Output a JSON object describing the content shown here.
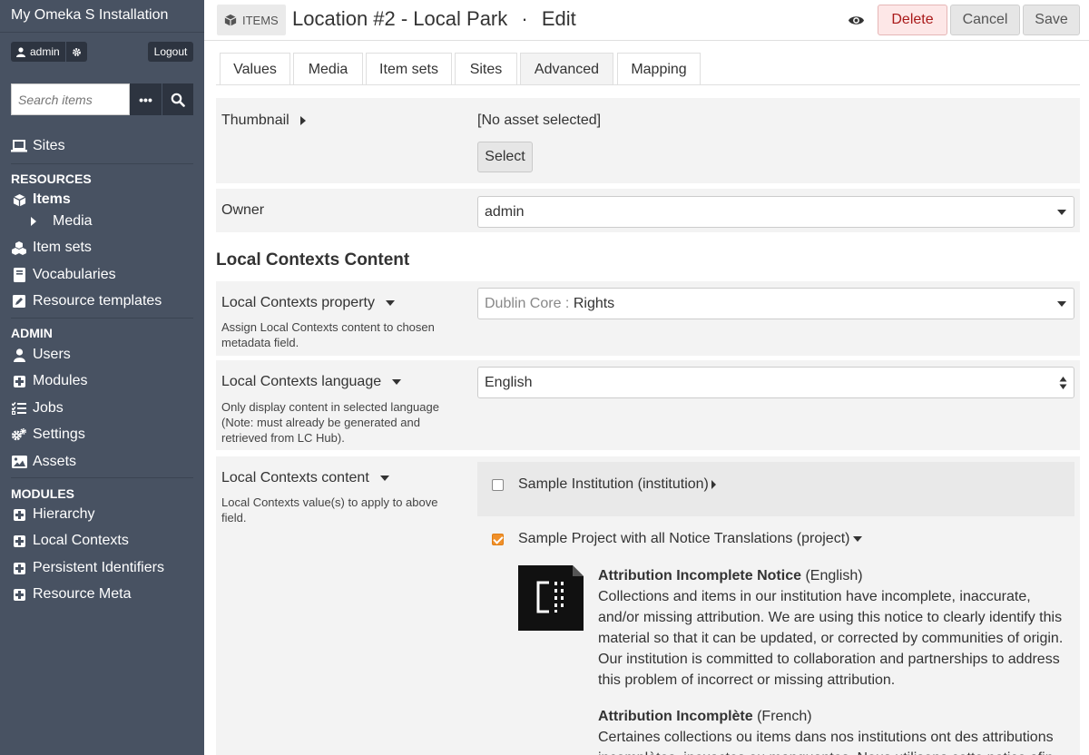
{
  "sidebar": {
    "install_title": "My Omeka S Installation",
    "user_name": "admin",
    "logout_label": "Logout",
    "search_placeholder": "Search items",
    "search_options_label": "•••",
    "sites_label": "Sites",
    "resources_heading": "RESOURCES",
    "items_label": "Items",
    "media_label": "Media",
    "item_sets_label": "Item sets",
    "vocabularies_label": "Vocabularies",
    "resource_templates_label": "Resource templates",
    "admin_heading": "ADMIN",
    "users_label": "Users",
    "modules_label": "Modules",
    "jobs_label": "Jobs",
    "settings_label": "Settings",
    "assets_label": "Assets",
    "modules_heading": "MODULES",
    "hierarchy_label": "Hierarchy",
    "local_contexts_label": "Local Contexts",
    "persistent_identifiers_label": "Persistent Identifiers",
    "resource_meta_label": "Resource Meta"
  },
  "header": {
    "badge_label": "ITEMS",
    "title": "Location #2 - Local Park",
    "separator": "·",
    "action": "Edit",
    "delete_label": "Delete",
    "cancel_label": "Cancel",
    "save_label": "Save"
  },
  "tabs": {
    "values": "Values",
    "media": "Media",
    "item_sets": "Item sets",
    "sites": "Sites",
    "advanced": "Advanced",
    "mapping": "Mapping"
  },
  "form": {
    "thumbnail_label": "Thumbnail",
    "thumbnail_value": "[No asset selected]",
    "select_button": "Select",
    "owner_label": "Owner",
    "owner_value": "admin",
    "section_heading": "Local Contexts Content",
    "lc_property_label": "Local Contexts property",
    "lc_property_desc": "Assign Local Contexts content to chosen metadata field.",
    "lc_property_vocab": "Dublin Core",
    "lc_property_colon": " : ",
    "lc_property_term": "Rights",
    "lc_language_label": "Local Contexts language",
    "lc_language_desc": "Only display content in selected language (Note: must already be generated and retrieved from LC Hub).",
    "lc_language_value": "English",
    "lc_content_label": "Local Contexts content",
    "lc_content_desc": "Local Contexts value(s) to apply to above field.",
    "institution_label": "Sample Institution (institution)",
    "institution_checked": false,
    "project_label": "Sample Project with all Notice Translations (project)",
    "project_checked": true
  },
  "notices": [
    {
      "title": "Attribution Incomplete Notice",
      "lang": " (English)",
      "text": "Collections and items in our institution have incomplete, inaccurate, and/or missing attribution. We are using this notice to clearly identify this material so that it can be updated, or corrected by communities of origin. Our institution is committed to collaboration and partnerships to address this problem of incorrect or missing attribution."
    },
    {
      "title": "Attribution Incomplète",
      "lang": " (French)",
      "text": "Certaines collections ou items dans nos institutions ont des attributions incomplètes, inexactes ou manquantes. Nous utilisons cette notice afin d'identifier"
    }
  ],
  "colors": {
    "sidebar_bg": "#485262",
    "accent_orange": "#f0902a",
    "delete_text": "#a91919"
  }
}
